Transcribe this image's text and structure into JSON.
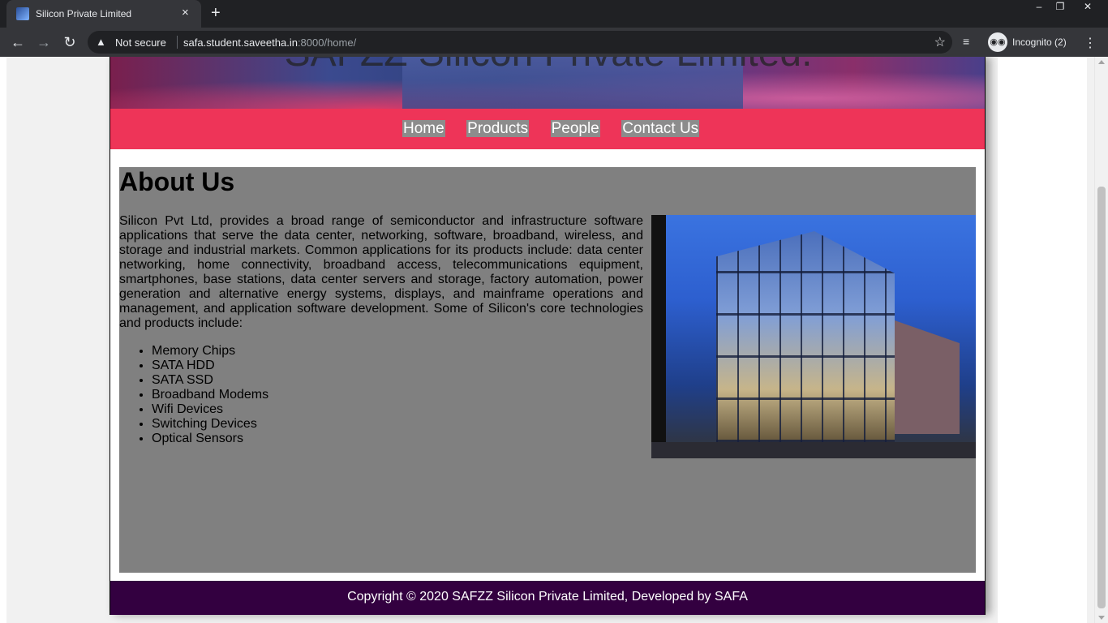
{
  "browser": {
    "tab_title": "Silicon Private Limited",
    "tab_close": "×",
    "new_tab": "+",
    "window_minimize": "–",
    "window_restore": "❐",
    "window_close": "✕",
    "back": "←",
    "forward": "→",
    "reload": "↻",
    "security_icon": "▲",
    "security_label": "Not secure",
    "url_host": "safa.student.saveetha.in",
    "url_path": ":8000/home/",
    "bookmark_star": "☆",
    "reading_list": "≡",
    "incognito_label": "Incognito (2)",
    "incognito_icon": "◉◉",
    "menu_icon": "⋮"
  },
  "site": {
    "banner_heading": "SAFZZ Silicon Private Limited.",
    "nav": [
      "Home",
      "Products",
      "People",
      "Contact Us"
    ],
    "about_heading": "About Us",
    "description": "Silicon Pvt Ltd, provides a broad range of semiconductor and infrastructure software applications that serve the data center, networking, software, broadband, wireless, and storage and industrial markets. Common applications for its products include: data center networking, home connectivity, broadband access, telecommunications equipment, smartphones, base stations, data center servers and storage, factory automation, power generation and alternative energy systems, displays, and mainframe operations and management, and application software development. Some of Silicon's core technologies and products include:",
    "items": [
      "Memory Chips",
      "SATA HDD",
      "SATA SSD",
      "Broadband Modems",
      "Wifi Devices",
      "Switching Devices",
      "Optical Sensors"
    ],
    "footer": "Copyright © 2020 SAFZZ Silicon Private Limited, Developed by SAFA"
  },
  "colors": {
    "nav_bg": "#ee3458",
    "content_bg": "#808080",
    "footer_bg": "#330040"
  }
}
